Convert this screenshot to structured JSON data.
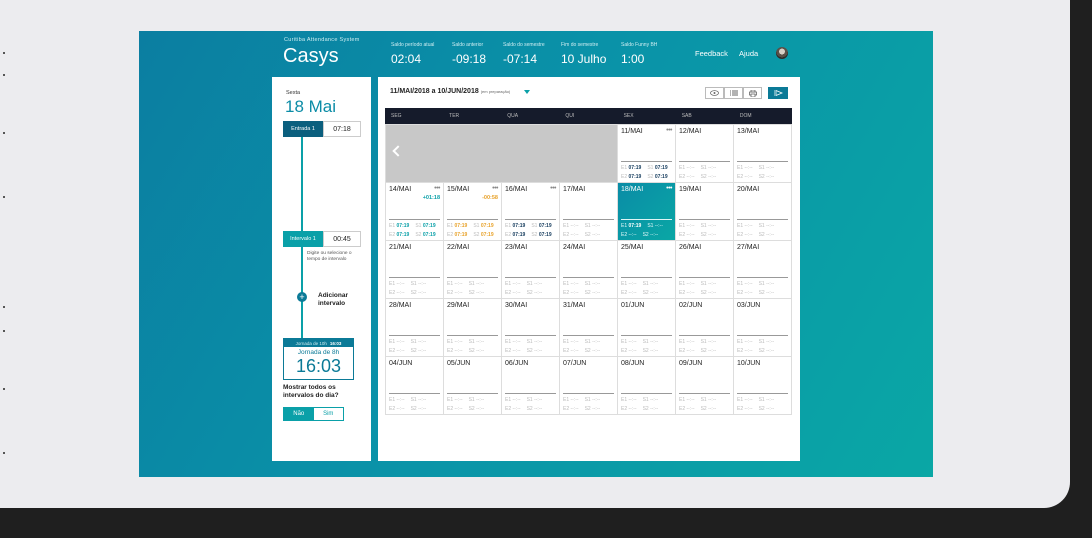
{
  "app": {
    "subtitle": "Curitiba Attendance System",
    "name": "Casys"
  },
  "header": {
    "stats": [
      {
        "label": "Saldo período atual",
        "value": "02:04"
      },
      {
        "label": "Saldo anterior",
        "value": "-09:18"
      },
      {
        "label": "Saldo do semestre",
        "value": "-07:14"
      },
      {
        "label": "Fim do semestre",
        "value": "10 Julho"
      },
      {
        "label": "Saldo Funny BH",
        "value": "1:00"
      }
    ],
    "feedback": "Feedback",
    "help": "Ajuda"
  },
  "day_panel": {
    "weekday": "Sexta",
    "date": "18 Mai",
    "entrada_label": "Entrada 1",
    "entrada_value": "07:18",
    "intervalo_label": "Intervalo 1",
    "intervalo_value": "00:45",
    "hint": "Digite ou selecione o tempo de intervalo",
    "add_label": "Adicionar intervalo",
    "jornada_top_label": "Jornada de 10h",
    "jornada_top_value": "16:03",
    "jornada_label": "Jornada de 8h",
    "jornada_value": "16:03",
    "question": "Mostrar todos os intervalos do dia?",
    "no": "Não",
    "yes": "Sim"
  },
  "calendar": {
    "range": "11/MAI/2018 a 10/JUN/2018",
    "range_note": "(em preparação)",
    "weekdays": [
      "SEG",
      "TER",
      "QUA",
      "QUI",
      "SEX",
      "SAB",
      "DOM"
    ],
    "dots": "•••",
    "empty": "--:--",
    "e1": "E1",
    "s1": "S1",
    "e2": "E2",
    "s2": "S2",
    "week1": [
      {
        "day": "11/MAI",
        "dots": true,
        "e1": "07:19",
        "s1": "07:19",
        "e2": "07:19",
        "s2": "07:19"
      },
      {
        "day": "12/MAI"
      },
      {
        "day": "13/MAI"
      }
    ],
    "week2": [
      {
        "day": "14/MAI",
        "dots": true,
        "balance": "+01:18",
        "e1": "07:19",
        "s1": "07:19",
        "e2": "07:19",
        "s2": "07:19"
      },
      {
        "day": "15/MAI",
        "dots": true,
        "balance": "-00:58",
        "e1": "07:19",
        "s1": "07:19",
        "e2": "07:19",
        "s2": "07:19"
      },
      {
        "day": "16/MAI",
        "dots": true,
        "e1": "07:19",
        "s1": "07:19",
        "e2": "07:19",
        "s2": "07:19"
      },
      {
        "day": "17/MAI"
      },
      {
        "day": "18/MAI",
        "dots": true,
        "e1": "07:19"
      },
      {
        "day": "19/MAI"
      },
      {
        "day": "20/MAI"
      }
    ],
    "week3": [
      "21/MAI",
      "22/MAI",
      "23/MAI",
      "24/MAI",
      "25/MAI",
      "26/MAI",
      "27/MAI"
    ],
    "week4": [
      "28/MAI",
      "29/MAI",
      "30/MAI",
      "31/MAI",
      "01/JUN",
      "02/JUN",
      "03/JUN"
    ],
    "week5": [
      "04/JUN",
      "05/JUN",
      "06/JUN",
      "07/JUN",
      "08/JUN",
      "09/JUN",
      "10/JUN"
    ]
  },
  "colors": {
    "accent": "#0aa0a8",
    "dark": "#0b7a97",
    "positive": "#0aa0a8",
    "negative": "#e8a22a"
  }
}
